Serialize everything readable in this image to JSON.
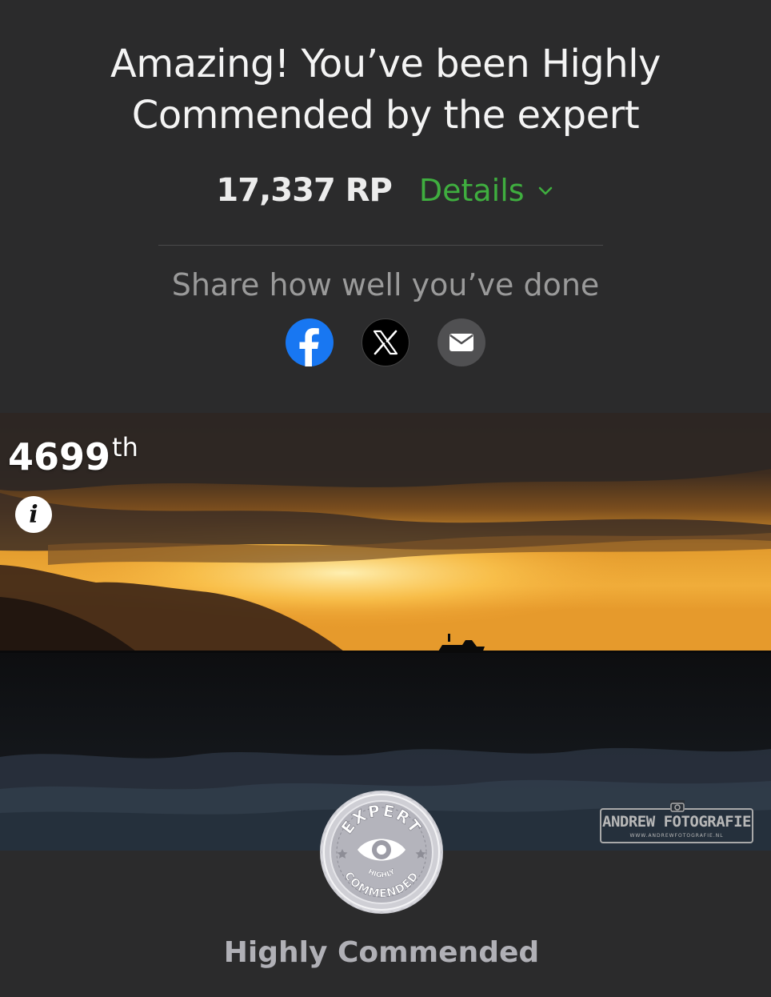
{
  "headline": {
    "line1": "Amazing! You’ve been Highly",
    "line2": "Commended by the expert"
  },
  "points": "17,337 RP",
  "details_label": "Details",
  "share": {
    "label": "Share how well you’ve done",
    "buttons": [
      {
        "network": "facebook",
        "icon": "facebook-icon",
        "color": "#1877f2"
      },
      {
        "network": "x",
        "icon": "x-icon",
        "color": "#000000"
      },
      {
        "network": "email",
        "icon": "mail-icon",
        "color": "#505052"
      }
    ]
  },
  "photo": {
    "rank_number": "4699",
    "rank_suffix": "th",
    "info_icon": "i",
    "watermark": "ANDREW FOTOGRAFIE",
    "watermark_url": "WWW.ANDREWFOTOGRAFIE.NL"
  },
  "award": {
    "badge_top": "EXPERT",
    "badge_mid": "HIGHLY",
    "badge_bottom": "COMMENDED",
    "label": "Highly Commended"
  },
  "colors": {
    "background": "#2b2b2c",
    "details": "#3fae3f",
    "facebook": "#1877f2"
  }
}
